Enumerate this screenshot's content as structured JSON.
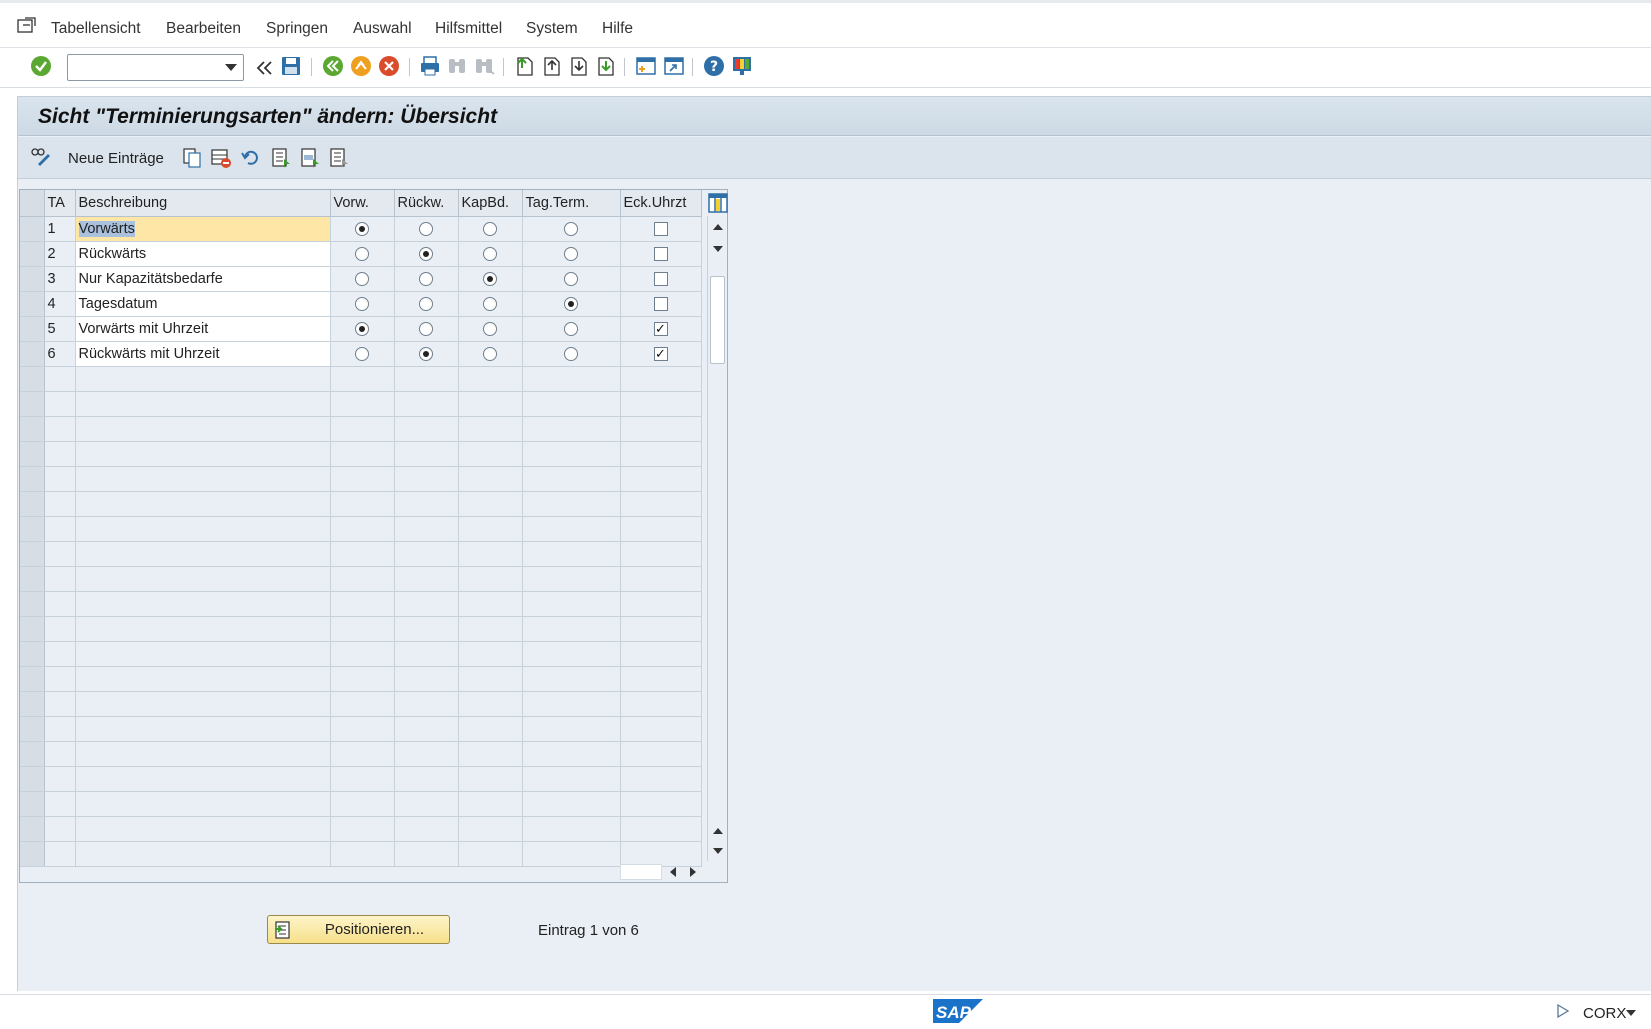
{
  "menu": {
    "items": [
      {
        "label": "Tabellensicht"
      },
      {
        "label": "Bearbeiten"
      },
      {
        "label": "Springen"
      },
      {
        "label": "Auswahl"
      },
      {
        "label": "Hilfsmittel"
      },
      {
        "label": "System"
      },
      {
        "label": "Hilfe"
      }
    ]
  },
  "toolbar": {
    "command_field_value": "",
    "icons": [
      "enter-icon",
      "back-arrows-icon",
      "save-icon",
      "back-icon",
      "exit-icon",
      "cancel-icon",
      "print-icon",
      "find-icon",
      "find-next-icon",
      "first-page-icon",
      "previous-page-icon",
      "next-page-icon",
      "last-page-icon",
      "create-session-icon",
      "shortcut-icon",
      "help-icon",
      "customize-layout-icon"
    ]
  },
  "title": "Sicht \"Terminierungsarten\" ändern: Übersicht",
  "app_toolbar": {
    "new_entries_label": "Neue Einträge"
  },
  "table": {
    "headers": {
      "ta": "TA",
      "desc": "Beschreibung",
      "vorw": "Vorw.",
      "rueckw": "Rückw.",
      "kapbd": "KapBd.",
      "tagterm": "Tag.Term.",
      "eckuhrzt": "Eck.Uhrzt"
    },
    "rows": [
      {
        "ta": "1",
        "desc": "Vorwärts",
        "radio": "vorw",
        "eck": false
      },
      {
        "ta": "2",
        "desc": "Rückwärts",
        "radio": "rueckw",
        "eck": false
      },
      {
        "ta": "3",
        "desc": "Nur Kapazitätsbedarfe",
        "radio": "kapbd",
        "eck": false
      },
      {
        "ta": "4",
        "desc": "Tagesdatum",
        "radio": "tagterm",
        "eck": false
      },
      {
        "ta": "5",
        "desc": "Vorwärts mit Uhrzeit",
        "radio": "vorw",
        "eck": true
      },
      {
        "ta": "6",
        "desc": "Rückwärts mit Uhrzeit",
        "radio": "rueckw",
        "eck": true
      }
    ],
    "empty_rows": 20
  },
  "footer": {
    "position_button": "Positionieren...",
    "entry_info": "Eintrag 1 von 6"
  },
  "status": {
    "system": "CORX",
    "logo": "SAP"
  },
  "colors": {
    "panel_bg": "#e9eff5",
    "title_bg": "#d9e4ee",
    "active_cell": "#fde6a6",
    "button_yellow": "#f7e08a",
    "sap_blue": "#1a73c8"
  }
}
